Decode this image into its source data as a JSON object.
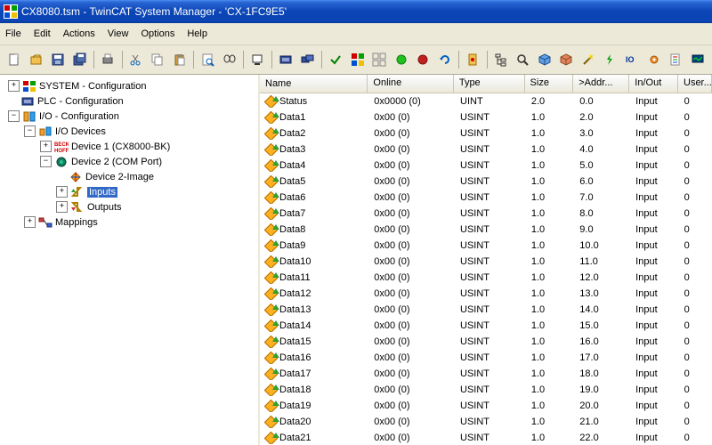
{
  "title": "CX8080.tsm - TwinCAT System Manager - 'CX-1FC9E5'",
  "menu": [
    "File",
    "Edit",
    "Actions",
    "View",
    "Options",
    "Help"
  ],
  "tree": {
    "system": "SYSTEM - Configuration",
    "plc": "PLC - Configuration",
    "io": "I/O - Configuration",
    "iod": "I/O Devices",
    "dev1": "Device 1 (CX8000-BK)",
    "dev2": "Device 2 (COM Port)",
    "img2": "Device 2-Image",
    "inputs": "Inputs",
    "outputs": "Outputs",
    "mappings": "Mappings"
  },
  "cols": [
    "Name",
    "Online",
    "Type",
    "Size",
    ">Addr...",
    "In/Out",
    "User..."
  ],
  "rows": [
    {
      "n": "Status",
      "o": "0x0000 (0)",
      "t": "UINT",
      "s": "2.0",
      "a": "0.0",
      "io": "Input",
      "u": "0"
    },
    {
      "n": "Data1",
      "o": "0x00 (0)",
      "t": "USINT",
      "s": "1.0",
      "a": "2.0",
      "io": "Input",
      "u": "0"
    },
    {
      "n": "Data2",
      "o": "0x00 (0)",
      "t": "USINT",
      "s": "1.0",
      "a": "3.0",
      "io": "Input",
      "u": "0"
    },
    {
      "n": "Data3",
      "o": "0x00 (0)",
      "t": "USINT",
      "s": "1.0",
      "a": "4.0",
      "io": "Input",
      "u": "0"
    },
    {
      "n": "Data4",
      "o": "0x00 (0)",
      "t": "USINT",
      "s": "1.0",
      "a": "5.0",
      "io": "Input",
      "u": "0"
    },
    {
      "n": "Data5",
      "o": "0x00 (0)",
      "t": "USINT",
      "s": "1.0",
      "a": "6.0",
      "io": "Input",
      "u": "0"
    },
    {
      "n": "Data6",
      "o": "0x00 (0)",
      "t": "USINT",
      "s": "1.0",
      "a": "7.0",
      "io": "Input",
      "u": "0"
    },
    {
      "n": "Data7",
      "o": "0x00 (0)",
      "t": "USINT",
      "s": "1.0",
      "a": "8.0",
      "io": "Input",
      "u": "0"
    },
    {
      "n": "Data8",
      "o": "0x00 (0)",
      "t": "USINT",
      "s": "1.0",
      "a": "9.0",
      "io": "Input",
      "u": "0"
    },
    {
      "n": "Data9",
      "o": "0x00 (0)",
      "t": "USINT",
      "s": "1.0",
      "a": "10.0",
      "io": "Input",
      "u": "0"
    },
    {
      "n": "Data10",
      "o": "0x00 (0)",
      "t": "USINT",
      "s": "1.0",
      "a": "11.0",
      "io": "Input",
      "u": "0"
    },
    {
      "n": "Data11",
      "o": "0x00 (0)",
      "t": "USINT",
      "s": "1.0",
      "a": "12.0",
      "io": "Input",
      "u": "0"
    },
    {
      "n": "Data12",
      "o": "0x00 (0)",
      "t": "USINT",
      "s": "1.0",
      "a": "13.0",
      "io": "Input",
      "u": "0"
    },
    {
      "n": "Data13",
      "o": "0x00 (0)",
      "t": "USINT",
      "s": "1.0",
      "a": "14.0",
      "io": "Input",
      "u": "0"
    },
    {
      "n": "Data14",
      "o": "0x00 (0)",
      "t": "USINT",
      "s": "1.0",
      "a": "15.0",
      "io": "Input",
      "u": "0"
    },
    {
      "n": "Data15",
      "o": "0x00 (0)",
      "t": "USINT",
      "s": "1.0",
      "a": "16.0",
      "io": "Input",
      "u": "0"
    },
    {
      "n": "Data16",
      "o": "0x00 (0)",
      "t": "USINT",
      "s": "1.0",
      "a": "17.0",
      "io": "Input",
      "u": "0"
    },
    {
      "n": "Data17",
      "o": "0x00 (0)",
      "t": "USINT",
      "s": "1.0",
      "a": "18.0",
      "io": "Input",
      "u": "0"
    },
    {
      "n": "Data18",
      "o": "0x00 (0)",
      "t": "USINT",
      "s": "1.0",
      "a": "19.0",
      "io": "Input",
      "u": "0"
    },
    {
      "n": "Data19",
      "o": "0x00 (0)",
      "t": "USINT",
      "s": "1.0",
      "a": "20.0",
      "io": "Input",
      "u": "0"
    },
    {
      "n": "Data20",
      "o": "0x00 (0)",
      "t": "USINT",
      "s": "1.0",
      "a": "21.0",
      "io": "Input",
      "u": "0"
    },
    {
      "n": "Data21",
      "o": "0x00 (0)",
      "t": "USINT",
      "s": "1.0",
      "a": "22.0",
      "io": "Input",
      "u": "0"
    }
  ]
}
